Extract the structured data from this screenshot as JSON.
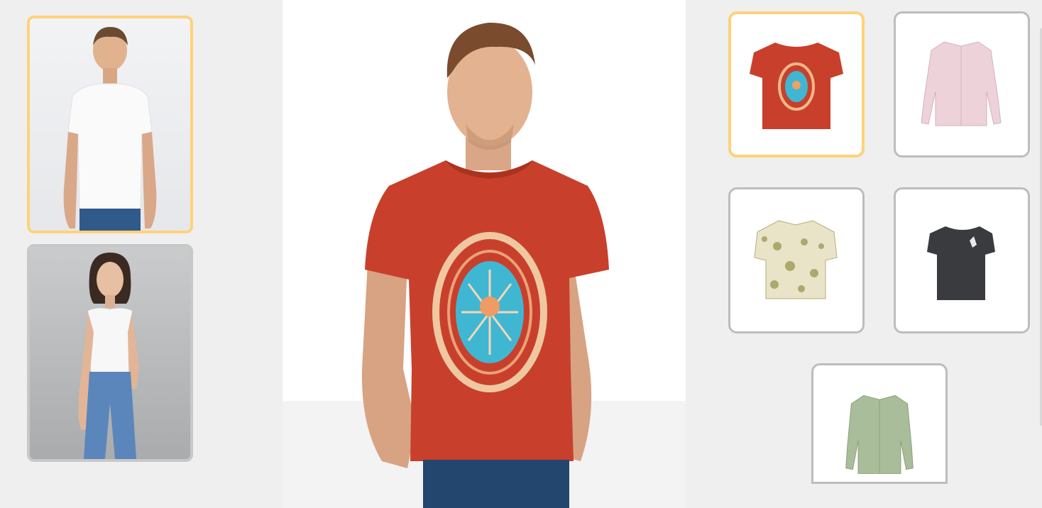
{
  "models": [
    {
      "id": "model-man",
      "selected": true
    },
    {
      "id": "model-woman",
      "selected": false
    }
  ],
  "garments": [
    {
      "id": "red-graphic-tshirt",
      "selected": true
    },
    {
      "id": "pink-dress-shirt",
      "selected": false
    },
    {
      "id": "floral-short-sleeve-shirt",
      "selected": false
    },
    {
      "id": "black-graphic-tshirt",
      "selected": false
    },
    {
      "id": "sage-green-shirt",
      "selected": false
    }
  ],
  "colors": {
    "selected_border": "#ffd27a",
    "unselected_border": "#c8c8c8",
    "panel_bg": "#efefef",
    "tshirt_red": "#c8402b"
  }
}
